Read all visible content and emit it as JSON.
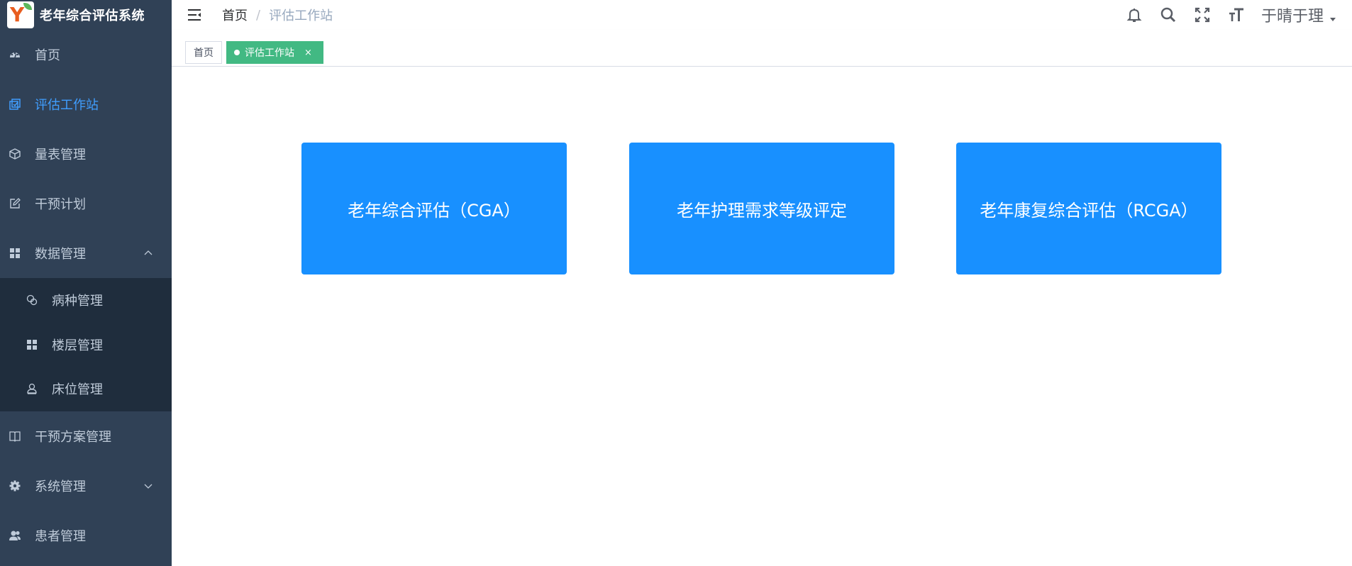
{
  "app": {
    "title": "老年综合评估系统"
  },
  "sidebar": {
    "items": [
      {
        "label": "首页",
        "icon": "dashboard-icon"
      },
      {
        "label": "评估工作站",
        "icon": "workstation-icon",
        "active": true
      },
      {
        "label": "量表管理",
        "icon": "cube-icon"
      },
      {
        "label": "干预计划",
        "icon": "edit-icon"
      },
      {
        "label": "数据管理",
        "icon": "grid-icon",
        "expanded": true
      }
    ],
    "sub_items": [
      {
        "label": "病种管理",
        "icon": "disease-icon"
      },
      {
        "label": "楼层管理",
        "icon": "grid-icon"
      },
      {
        "label": "床位管理",
        "icon": "person-icon"
      }
    ],
    "items_after": [
      {
        "label": "干预方案管理",
        "icon": "book-icon"
      },
      {
        "label": "系统管理",
        "icon": "gear-icon",
        "expandable": true
      },
      {
        "label": "患者管理",
        "icon": "users-icon"
      }
    ]
  },
  "header": {
    "breadcrumb": {
      "home": "首页",
      "separator": "/",
      "current": "评估工作站"
    },
    "user_name": "于晴于理"
  },
  "tags": {
    "home": "首页",
    "current": "评估工作站",
    "close": "×"
  },
  "cards": [
    {
      "label": "老年综合评估（CGA）"
    },
    {
      "label": "老年护理需求等级评定"
    },
    {
      "label": "老年康复综合评估（RCGA）"
    }
  ],
  "colors": {
    "sidebar_bg": "#304156",
    "submenu_bg": "#1f2d3d",
    "active": "#409eff",
    "card": "#1890ff",
    "tag_active": "#42b983"
  }
}
